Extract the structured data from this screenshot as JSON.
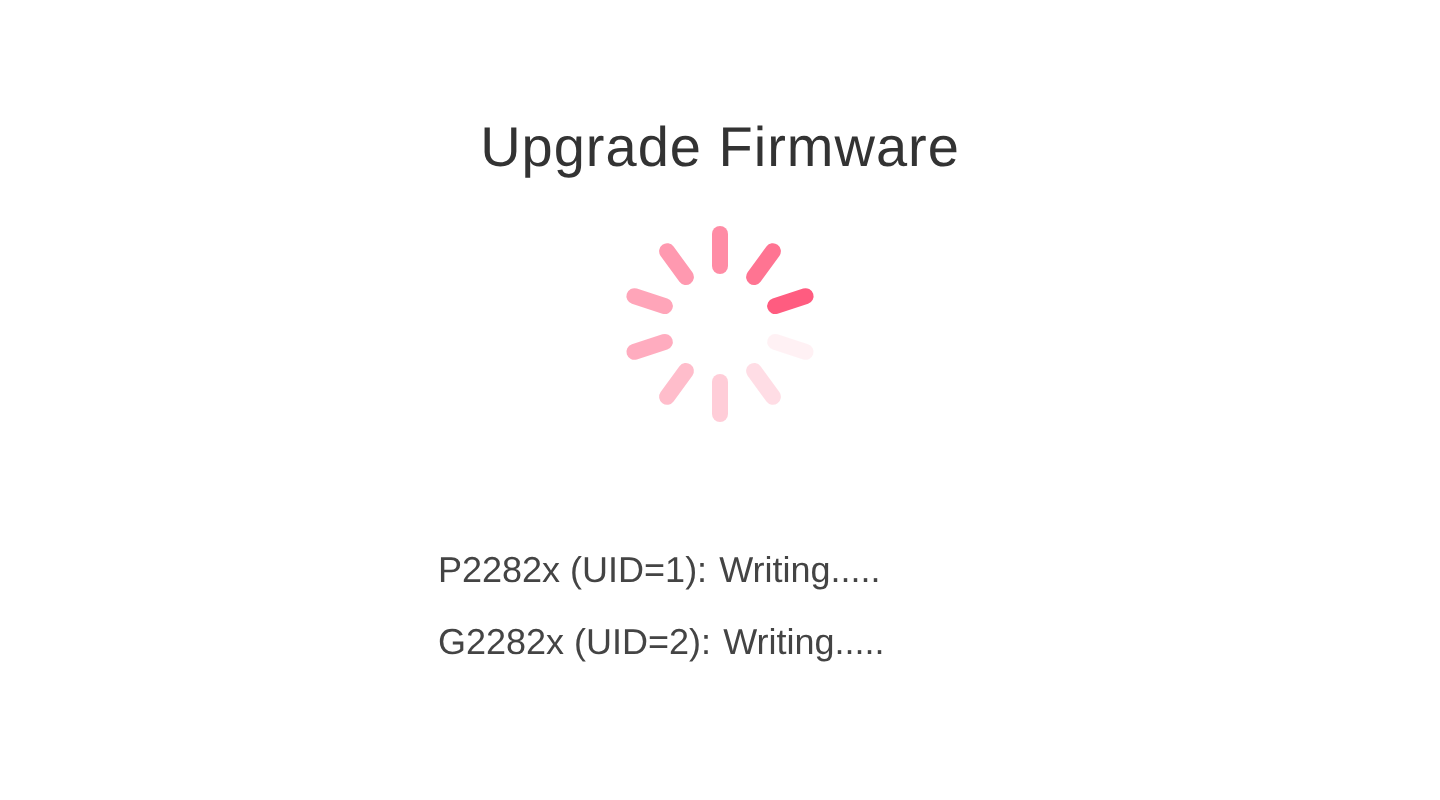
{
  "title": "Upgrade Firmware",
  "devices": [
    {
      "label": "P2282x (UID=1):",
      "status": "Writing....."
    },
    {
      "label": "G2282x (UID=2):",
      "status": "Writing....."
    }
  ]
}
